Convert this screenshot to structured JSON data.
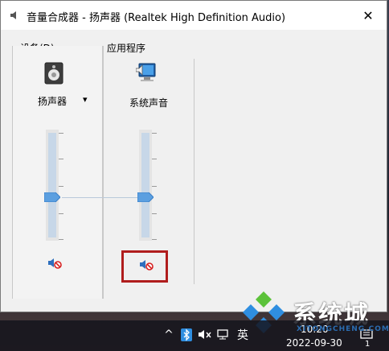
{
  "window": {
    "title": "音量合成器 - 扬声器 (Realtek High Definition Audio)",
    "close_glyph": "✕"
  },
  "device_section": {
    "label": "设备(D)",
    "device_name": "扬声器",
    "dropdown_glyph": "▾",
    "volume_level": 0.4,
    "muted": true
  },
  "apps_section": {
    "label": "应用程序",
    "apps": [
      {
        "name": "系统声音",
        "volume_level": 0.4,
        "muted": true
      }
    ]
  },
  "taskbar": {
    "show_hidden_glyph": "^",
    "ime_label": "英",
    "time": "10:20",
    "date": "2022-09-30",
    "notification_count": "1"
  },
  "watermark": {
    "text": "系统城",
    "sub": "XITONGCHENG.COM"
  },
  "colors": {
    "accent": "#3a8ee6",
    "highlight": "#b01d1d",
    "mute_red": "#d62020"
  },
  "icons": [
    "speaker-icon",
    "system-sounds-icon",
    "muted-speaker-icon",
    "close-icon",
    "chevron-down-icon"
  ]
}
